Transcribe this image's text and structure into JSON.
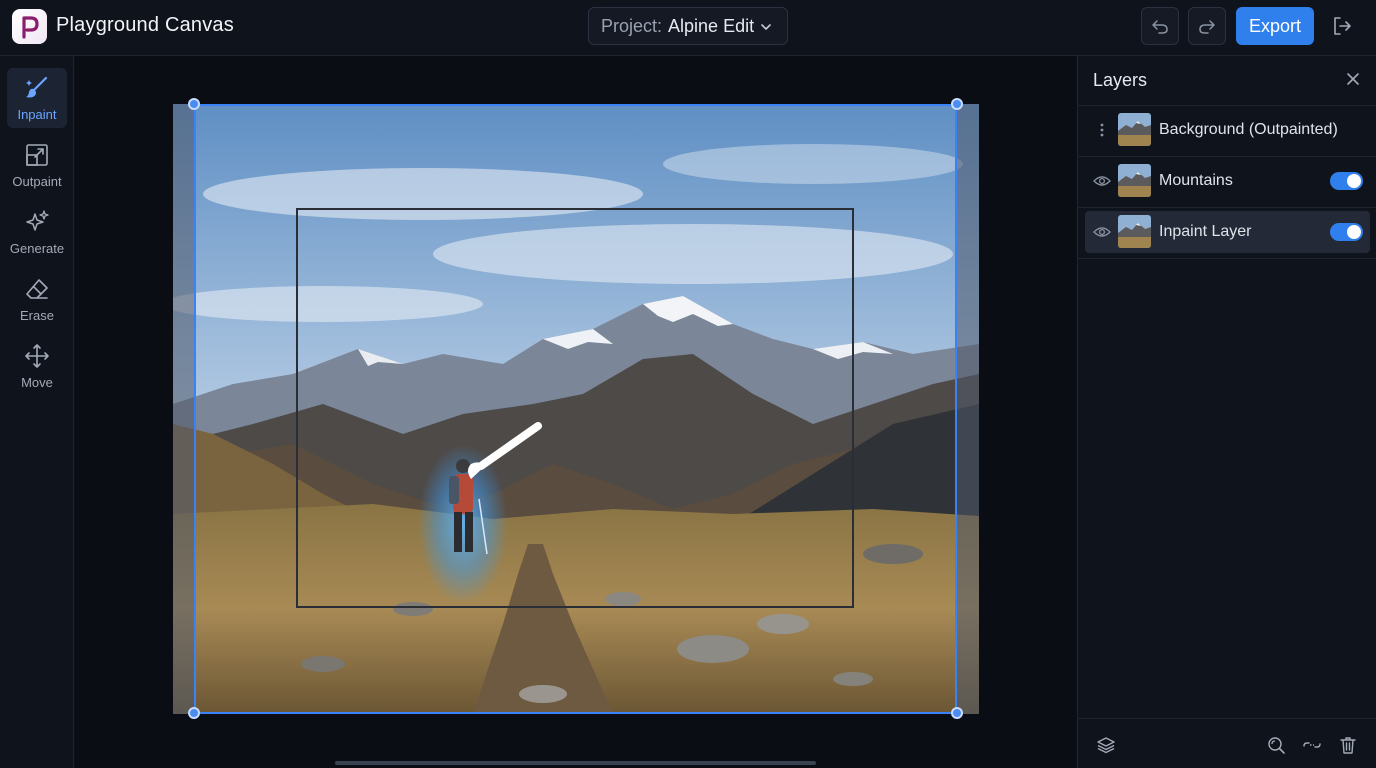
{
  "app": {
    "title": "Playground Canvas"
  },
  "header": {
    "project_label": "Project:",
    "project_value": "Alpine Edit",
    "export_label": "Export"
  },
  "tools": [
    {
      "label": "Inpaint",
      "icon": "brush-icon",
      "active": true
    },
    {
      "label": "Outpaint",
      "icon": "outpaint-icon",
      "active": false
    },
    {
      "label": "Generate",
      "icon": "sparkles-icon",
      "active": false
    },
    {
      "label": "Erase",
      "icon": "eraser-icon",
      "active": false
    },
    {
      "label": "Move",
      "icon": "move-icon",
      "active": false
    }
  ],
  "layers_panel": {
    "title": "Layers",
    "layers": [
      {
        "name": "Background (Outpainted)",
        "lead_icon": "drag-handle-icon",
        "toggle": null,
        "selected": false
      },
      {
        "name": "Mountains",
        "lead_icon": "eye-icon",
        "toggle": true,
        "selected": false
      },
      {
        "name": "Inpaint Layer",
        "lead_icon": "eye-icon",
        "toggle": true,
        "selected": true
      }
    ],
    "footer_icons": [
      "layers-icon",
      "zoom-reset-icon",
      "link-icon",
      "trash-icon"
    ]
  },
  "colors": {
    "accent": "#2f80ed",
    "background": "#0b0f17",
    "panel": "#0f131b",
    "selection": "#3b82f6"
  }
}
